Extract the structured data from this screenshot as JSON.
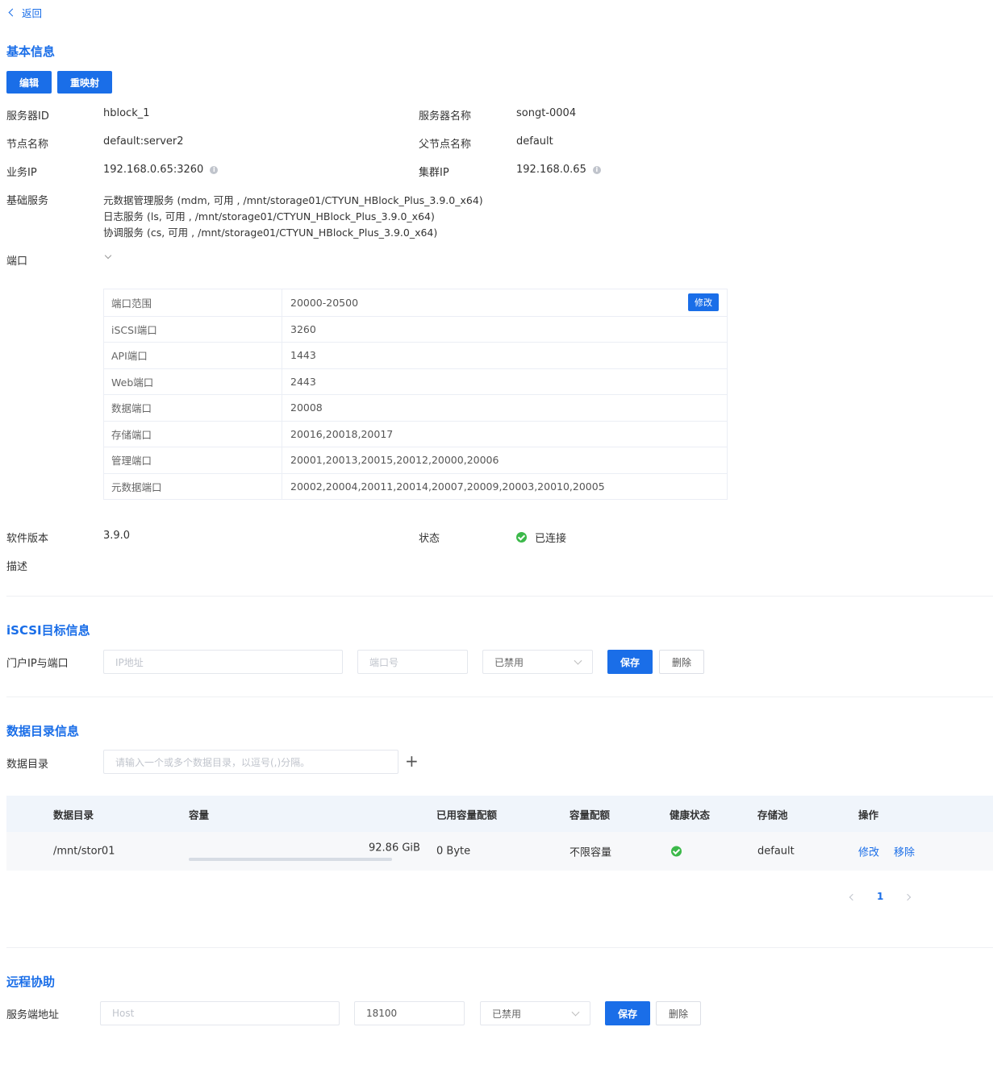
{
  "nav": {
    "back_label": "返回"
  },
  "basic": {
    "title": "基本信息",
    "edit_button": "编辑",
    "remap_button": "重映射",
    "server_id_label": "服务器ID",
    "server_id": "hblock_1",
    "server_name_label": "服务器名称",
    "server_name": "songt-0004",
    "node_name_label": "节点名称",
    "node_name": "default:server2",
    "parent_node_label": "父节点名称",
    "parent_node": "default",
    "service_ip_label": "业务IP",
    "service_ip": "192.168.0.65:3260",
    "cluster_ip_label": "集群IP",
    "cluster_ip": "192.168.0.65",
    "base_service_label": "基础服务",
    "base_services": [
      "元数据管理服务 (mdm, 可用 , /mnt/storage01/CTYUN_HBlock_Plus_3.9.0_x64)",
      "日志服务 (ls, 可用 , /mnt/storage01/CTYUN_HBlock_Plus_3.9.0_x64)",
      "协调服务 (cs, 可用 , /mnt/storage01/CTYUN_HBlock_Plus_3.9.0_x64)"
    ],
    "port_label": "端口",
    "ports": [
      {
        "name": "端口范围",
        "value": "20000-20500",
        "action": "修改"
      },
      {
        "name": "iSCSI端口",
        "value": "3260"
      },
      {
        "name": "API端口",
        "value": "1443"
      },
      {
        "name": "Web端口",
        "value": "2443"
      },
      {
        "name": "数据端口",
        "value": "20008"
      },
      {
        "name": "存储端口",
        "value": "20016,20018,20017"
      },
      {
        "name": "管理端口",
        "value": "20001,20013,20015,20012,20000,20006"
      },
      {
        "name": "元数据端口",
        "value": "20002,20004,20011,20014,20007,20009,20003,20010,20005"
      }
    ],
    "version_label": "软件版本",
    "version": "3.9.0",
    "status_label": "状态",
    "status": "已连接",
    "status_color": "#3cb94a",
    "desc_label": "描述"
  },
  "iscsi": {
    "title": "iSCSI目标信息",
    "portal_label": "门户IP与端口",
    "ip_placeholder": "IP地址",
    "port_placeholder": "端口号",
    "select_value": "已禁用",
    "save_button": "保存",
    "delete_button": "删除"
  },
  "datadir": {
    "title": "数据目录信息",
    "dir_label": "数据目录",
    "dir_placeholder": "请输入一个或多个数据目录，以逗号(,)分隔。",
    "add_symbol": "+",
    "columns": [
      "数据目录",
      "容量",
      "已用容量配额",
      "容量配额",
      "健康状态",
      "存储池",
      "操作"
    ],
    "rows": [
      {
        "dir": "/mnt/stor01",
        "capacity": "92.86 GiB",
        "used_quota": "0 Byte",
        "quota": "不限容量",
        "pool": "default",
        "edit": "修改",
        "remove": "移除"
      }
    ],
    "pager_page": "1"
  },
  "remote": {
    "title": "远程协助",
    "addr_label": "服务端地址",
    "host_placeholder": "Host",
    "port_value": "18100",
    "select_value": "已禁用",
    "save_button": "保存",
    "delete_button": "删除"
  },
  "colors": {
    "primary": "#1a6ee8",
    "success": "#3cb94a"
  }
}
